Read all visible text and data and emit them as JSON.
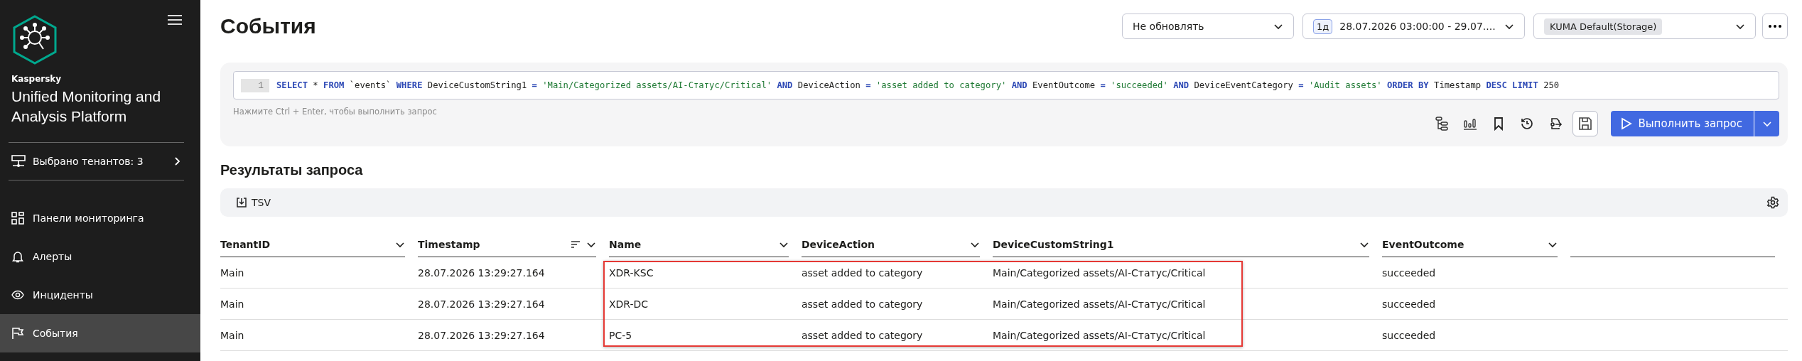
{
  "sidebar": {
    "brand": "Kaspersky",
    "product": "Unified Monitoring and Analysis Platform",
    "tenants": "Выбрано тенантов: 3",
    "items": [
      {
        "label": "Панели мониторинга",
        "kind": "dashboard",
        "selected": false
      },
      {
        "label": "Алерты",
        "kind": "alerts",
        "selected": false
      },
      {
        "label": "Инциденты",
        "kind": "incidents",
        "selected": false
      },
      {
        "label": "События",
        "kind": "events",
        "selected": true
      }
    ]
  },
  "header": {
    "title": "События",
    "refresh": "Не обновлять",
    "period_badge": "1д",
    "period": "28.07.2026 03:00:00 - 29.07....",
    "storage": "KUMA Default(Storage)"
  },
  "query": {
    "line_number": "1",
    "hint": "Нажмите Ctrl + Enter, чтобы выполнить запрос",
    "run_button": "Выполнить запрос",
    "tokens": [
      {
        "text": "SELECT",
        "kind": "keyword"
      },
      {
        "text": " * ",
        "kind": "plain"
      },
      {
        "text": "FROM",
        "kind": "keyword"
      },
      {
        "text": " `events` ",
        "kind": "plain"
      },
      {
        "text": "WHERE",
        "kind": "keyword"
      },
      {
        "text": " DeviceCustomString1 ",
        "kind": "plain"
      },
      {
        "text": "=",
        "kind": "operator"
      },
      {
        "text": " 'Main/Categorized assets/AI-Статус/Critical' ",
        "kind": "string"
      },
      {
        "text": "AND",
        "kind": "keyword"
      },
      {
        "text": " DeviceAction ",
        "kind": "plain"
      },
      {
        "text": "=",
        "kind": "operator"
      },
      {
        "text": " 'asset added to category' ",
        "kind": "string"
      },
      {
        "text": "AND",
        "kind": "keyword"
      },
      {
        "text": " EventOutcome ",
        "kind": "plain"
      },
      {
        "text": "=",
        "kind": "operator"
      },
      {
        "text": " 'succeeded' ",
        "kind": "string"
      },
      {
        "text": "AND",
        "kind": "keyword"
      },
      {
        "text": " DeviceEventCategory ",
        "kind": "plain"
      },
      {
        "text": "=",
        "kind": "operator"
      },
      {
        "text": " 'Audit assets' ",
        "kind": "string"
      },
      {
        "text": "ORDER BY",
        "kind": "keyword"
      },
      {
        "text": " Timestamp ",
        "kind": "plain"
      },
      {
        "text": "DESC LIMIT",
        "kind": "keyword"
      },
      {
        "text": " 250",
        "kind": "plain"
      }
    ]
  },
  "results": {
    "title": "Результаты запроса",
    "export_button": "TSV",
    "columns": [
      {
        "label": "TenantID",
        "sorted": false,
        "highlighted": false
      },
      {
        "label": "Timestamp",
        "sorted": true,
        "highlighted": false
      },
      {
        "label": "Name",
        "sorted": false,
        "highlighted": true
      },
      {
        "label": "DeviceAction",
        "sorted": false,
        "highlighted": true
      },
      {
        "label": "DeviceCustomString1",
        "sorted": false,
        "highlighted": true
      },
      {
        "label": "EventOutcome",
        "sorted": false,
        "highlighted": false
      }
    ],
    "rows": [
      [
        "Main",
        "28.07.2026 13:29:27.164",
        "XDR-KSC",
        "asset added to category",
        "Main/Categorized assets/AI-Статус/Critical",
        "succeeded"
      ],
      [
        "Main",
        "28.07.2026 13:29:27.164",
        "XDR-DC",
        "asset added to category",
        "Main/Categorized assets/AI-Статус/Critical",
        "succeeded"
      ],
      [
        "Main",
        "28.07.2026 13:29:27.164",
        "PC-5",
        "asset added to category",
        "Main/Categorized assets/AI-Статус/Critical",
        "succeeded"
      ]
    ]
  }
}
